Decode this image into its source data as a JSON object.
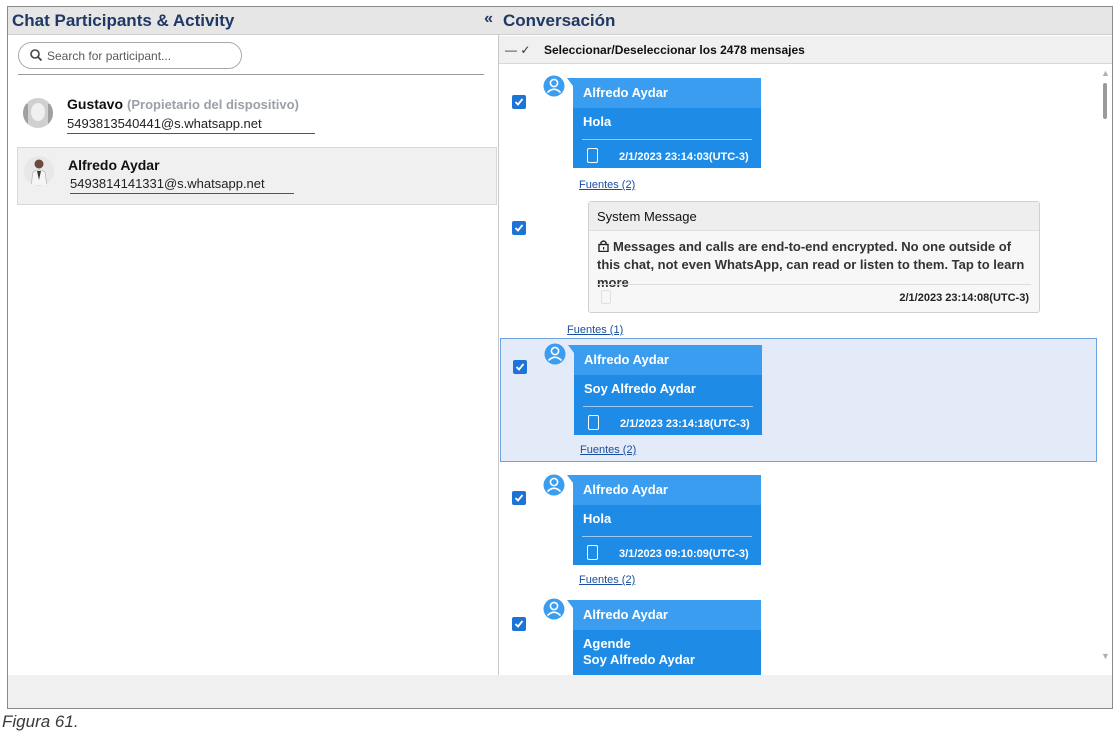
{
  "left_panel": {
    "title": "Chat Participants & Activity",
    "search": {
      "placeholder": "Search for participant..."
    },
    "participants": [
      {
        "name": "Gustavo",
        "role": "(Propietario del dispositivo)",
        "phone": "5493813540441@s.whatsapp.net"
      },
      {
        "name": "Alfredo Aydar",
        "role": "",
        "phone": "5493814141331@s.whatsapp.net"
      }
    ]
  },
  "right_panel": {
    "title": "Conversación",
    "select_all_label": "Seleccionar/Deseleccionar los 2478 mensajes",
    "messages": [
      {
        "sender": "Alfredo Aydar",
        "text": "Hola",
        "timestamp": "2/1/2023 23:14:03(UTC-3)",
        "sources": "Fuentes (2)",
        "checked": true
      },
      {
        "type": "system",
        "header": "System Message",
        "text": "Messages and calls are end-to-end encrypted. No one outside of this chat, not even WhatsApp, can read or listen to them. Tap to learn more",
        "timestamp": "2/1/2023 23:14:08(UTC-3)",
        "sources": "Fuentes (1)",
        "checked": true
      },
      {
        "sender": "Alfredo Aydar",
        "text": "Soy Alfredo Aydar",
        "timestamp": "2/1/2023 23:14:18(UTC-3)",
        "sources": "Fuentes (2)",
        "checked": true,
        "selected": true
      },
      {
        "sender": "Alfredo Aydar",
        "text": "Hola",
        "timestamp": "3/1/2023 09:10:09(UTC-3)",
        "sources": "Fuentes (2)",
        "checked": true
      },
      {
        "sender": "Alfredo Aydar",
        "text_lines": [
          "Agende",
          "Soy Alfredo Aydar"
        ],
        "checked": true
      }
    ]
  },
  "caption": "Figura 61.",
  "colors": {
    "bubble": "#1e8ce6",
    "bubble_head": "#3a9df0",
    "title": "#1f3864",
    "checkbox": "#1e73d6"
  }
}
